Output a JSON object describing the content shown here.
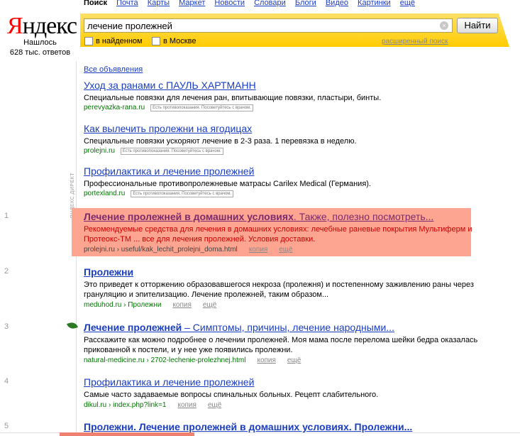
{
  "header": {
    "logo_first": "Я",
    "logo_rest": "ндекс",
    "found_line1": "Нашлось",
    "found_line2": "628 тыс. ответов",
    "nav": [
      "Поиск",
      "Почта",
      "Карты",
      "Маркет",
      "Новости",
      "Словари",
      "Блоги",
      "Видео",
      "Картинки",
      "ещё"
    ],
    "search_value": "лечение пролежней",
    "search_button": "Найти",
    "option_found": "в найденном",
    "option_moscow": "в Москве",
    "advanced": "расширенный поиск",
    "clear_icon": "×"
  },
  "ads_label": "Все объявления",
  "direct_label": "ЯНДЕКС.ДИРЕКТ",
  "ads": [
    {
      "title": "Уход за ранами с ПАУЛЬ ХАРТМАНН",
      "desc": "Специальные повязки для лечения ран, впитывающие повязки, пластыри, бинты.",
      "url": "perevyazka-rana.ru",
      "warning": "Есть противопоказания. Посоветуйтесь с врачом."
    },
    {
      "title": "Как вылечить пролежни на ягодицах",
      "desc": "Специальные повязки ускоряют лечение в 2-3 раза. 1 перевязка в неделю.",
      "url": "prolejni.ru",
      "warning": "Есть противопоказания. Посоветуйтесь с врачом."
    },
    {
      "title": "Профилактика и лечение пролежней",
      "desc": "Профессиональные противопролежневые матрасы Carilex Medical (Германия).",
      "url": "portexland.ru",
      "warning": "Есть противопоказания. Посоветуйтесь с врачом."
    }
  ],
  "results": [
    {
      "num": "1",
      "title": "Лечение пролежней в домашних условиях",
      "title_rest": ". Также, полезно посмотреть...",
      "desc": "Рекомендуемые средства для лечения в домашних условиях: лечебные раневые покрытия Мультиферм и Протеокс-ТМ ... все для лечения пролежней. Условия доставки.",
      "url": "prolejni.ru › useful/kak_lechit_prolejni_doma.html",
      "copy": "копия",
      "more": "ещё"
    },
    {
      "num": "2",
      "title": "Пролежни",
      "title_rest": "",
      "desc": "Это приведет к отторжению образовавшегося некроза (пролежня) и постепенному заживлению раны через грануляцию и эпителизацию. Лечение пролежней, таким образом...",
      "url": "meduhod.ru › Пролежни",
      "copy": "копия",
      "more": "ещё"
    },
    {
      "num": "3",
      "title": "Лечение пролежней",
      "title_rest": " – Симптомы, причины, лечение народными...",
      "desc": "Расскажите как можно подробнее о лечении пролежней. Моя мама после перелома шейки бедра оказалась прикованной к постели, и у нее уже появились пролежни.",
      "url": "natural-medicine.ru › 2702-lechenie-prolezhnej.html",
      "copy": "копия",
      "more": "ещё"
    },
    {
      "num": "4",
      "title": "Профилактика и лечение пролежней",
      "title_rest": "",
      "desc": "Самые часто задаваемые вопросы спинальных больных. Рецепт слабительного.",
      "url": "dikul.ru › index.php?link=1",
      "copy": "копия",
      "more": "ещё"
    },
    {
      "num": "5",
      "title": "Пролежни. Лечение пролежней в домашних условиях. Пролежни...",
      "title_rest": "",
      "desc": "",
      "url": "",
      "copy": "",
      "more": ""
    }
  ],
  "colors": {
    "link": "#1a3dc1",
    "url_green": "#007700",
    "highlight": "#fda591",
    "search_bar": "#ffcc00"
  }
}
